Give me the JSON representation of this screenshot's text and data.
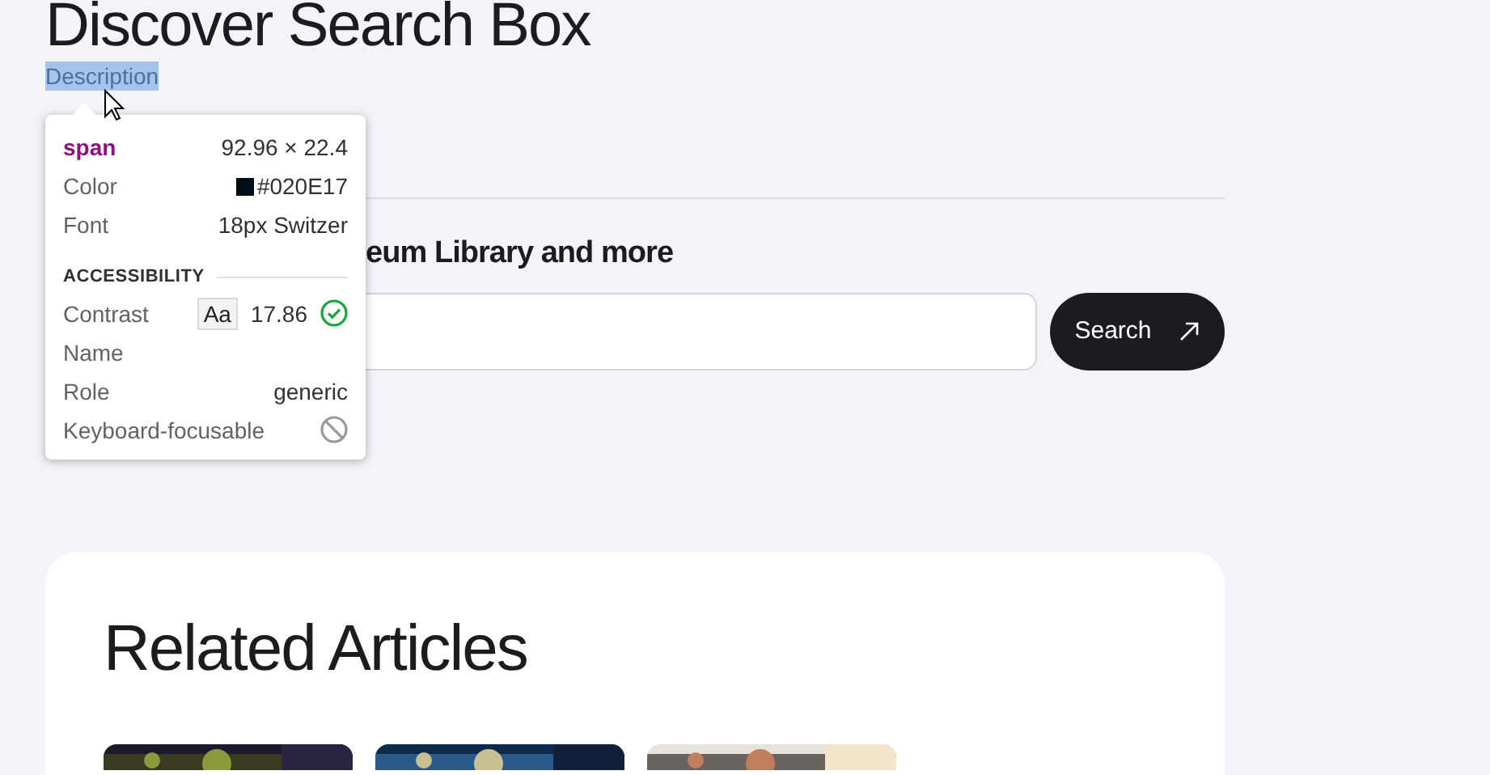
{
  "page": {
    "title": "Discover Search Box",
    "description": {
      "text": "Description",
      "selected": true
    }
  },
  "search": {
    "label": "eum Library and more",
    "button": "Search"
  },
  "related": {
    "title": "Related Articles"
  },
  "inspector": {
    "tag": "span",
    "size": "92.96 × 22.4",
    "rows": [
      {
        "label": "Color",
        "value": "#020E17",
        "color": "#020e17"
      },
      {
        "label": "Font",
        "value": "18px Switzer"
      }
    ],
    "section": "ACCESSIBILITY",
    "accessibility": [
      {
        "kind": "contrast",
        "label": "Contrast",
        "sample": "Aa",
        "value": "17.86"
      },
      {
        "kind": "text",
        "label": "Name"
      },
      {
        "kind": "text",
        "label": "Role",
        "value": "generic"
      },
      {
        "kind": "blocked",
        "label": "Keyboard-focusable"
      }
    ]
  }
}
